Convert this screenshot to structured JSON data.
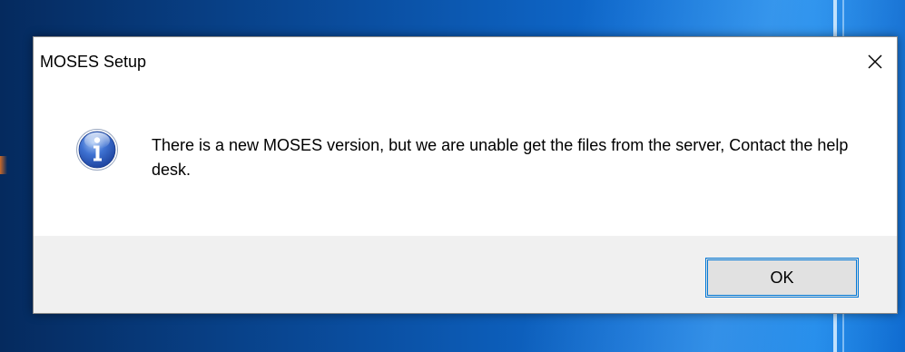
{
  "window": {
    "title": "MOSES Setup",
    "close_icon": "close-icon"
  },
  "message": {
    "icon": "info-icon",
    "text": "There is a new MOSES version, but we are unable get the files from the server, Contact the help desk."
  },
  "buttons": {
    "ok_label": "OK"
  },
  "colors": {
    "dialog_bg": "#ffffff",
    "footer_bg": "#f0f0f0",
    "button_border": "#0078d7",
    "info_icon_blue": "#2a5fc4"
  }
}
